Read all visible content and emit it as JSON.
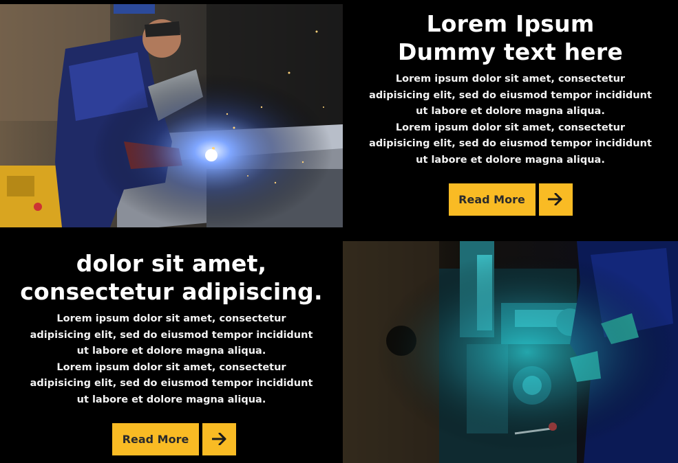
{
  "feature_top": {
    "title_line1": "Lorem Ipsum",
    "title_line2": "Dummy text here",
    "body_lines": [
      "Lorem ipsum dolor sit amet, consectetur",
      "adipisicing elit, sed do eiusmod tempor incididunt",
      "ut labore et dolore magna aliqua.",
      "Lorem ipsum dolor sit amet, consectetur",
      "adipisicing elit, sed do eiusmod tempor incididunt",
      "ut labore et dolore magna aliqua."
    ],
    "read_more_label": "Read More",
    "arrow_icon": "arrow-right-icon",
    "image": "welder-sparks-photo"
  },
  "feature_bottom": {
    "title_line1": "dolor sit amet,",
    "title_line2": "consectetur adipiscing.",
    "body_lines": [
      "Lorem ipsum dolor sit amet, consectetur",
      "adipisicing elit, sed do eiusmod tempor incididunt",
      "ut labore et dolore magna aliqua.",
      "Lorem ipsum dolor sit amet, consectetur",
      "adipisicing elit, sed do eiusmod tempor incididunt",
      "ut labore et dolore magna aliqua."
    ],
    "read_more_label": "Read More",
    "arrow_icon": "arrow-right-icon",
    "image": "lathe-machine-photo"
  },
  "colors": {
    "background": "#000000",
    "accent": "#f9bb24",
    "button_text": "#2b2b2b",
    "text": "#ffffff"
  }
}
